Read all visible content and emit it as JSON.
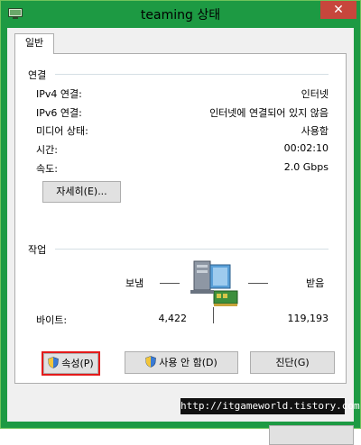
{
  "window": {
    "title": "teaming 상태",
    "close_glyph": "✕"
  },
  "tabs": [
    {
      "label": "일반"
    }
  ],
  "connection": {
    "group_title": "연결",
    "rows": [
      {
        "label": "IPv4 연결:",
        "value": "인터넷"
      },
      {
        "label": "IPv6 연결:",
        "value": "인터넷에 연결되어 있지 않음"
      },
      {
        "label": "미디어 상태:",
        "value": "사용함"
      },
      {
        "label": "시간:",
        "value": "00:02:10"
      },
      {
        "label": "속도:",
        "value": "2.0 Gbps"
      }
    ],
    "details_button": "자세히(E)..."
  },
  "activity": {
    "group_title": "작업",
    "sent_label": "보냄",
    "received_label": "받음",
    "bytes_label": "바이트:",
    "bytes_sent": "4,422",
    "bytes_received": "119,193"
  },
  "buttons": {
    "properties": "속성(P)",
    "disable": "사용 안 함(D)",
    "diagnose": "진단(G)"
  },
  "watermark": "http://itgameworld.tistory.com",
  "colors": {
    "titlebar": "#1d9a43",
    "close": "#c7463c",
    "highlight": "#e41a1a"
  }
}
